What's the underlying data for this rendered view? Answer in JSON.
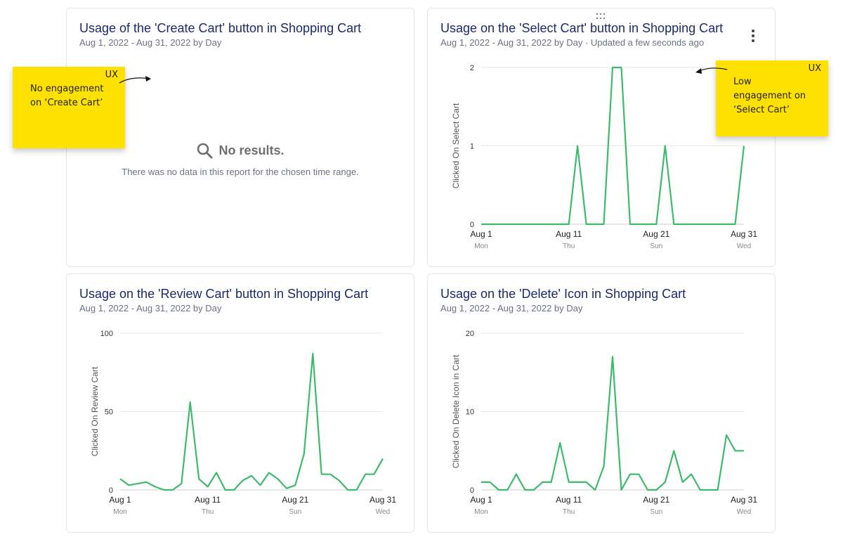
{
  "colors": {
    "line": "#3dbb6c",
    "title": "#1b2a6b",
    "sticky": "#ffe100",
    "grid": "#e6e6e6"
  },
  "cards": {
    "create": {
      "title": "Usage of the 'Create Cart' button in Shopping Cart",
      "subtitle": "Aug 1, 2022 - Aug 31, 2022 by Day",
      "empty_title": "No results.",
      "empty_message": "There was no data in this report for the chosen time range.",
      "empty_icon": "search-icon"
    },
    "select": {
      "title": "Usage on the 'Select Cart' button in Shopping Cart",
      "subtitle": "Aug 1, 2022 - Aug 31, 2022 by Day · Updated a few seconds ago",
      "menu_icon": "kebab-menu-icon",
      "drag_icon": "drag-handle-icon"
    },
    "review": {
      "title": "Usage on the 'Review Cart' button in Shopping Cart",
      "subtitle": "Aug 1, 2022 - Aug 31, 2022 by Day"
    },
    "delete": {
      "title": "Usage on the 'Delete' Icon in Shopping Cart",
      "subtitle": "Aug 1, 2022 - Aug 31, 2022 by Day"
    }
  },
  "stickies": {
    "create": {
      "tag": "UX",
      "text": "No engagement\non ‘Create Cart’"
    },
    "select": {
      "tag": "UX",
      "text": "Low\nengagement on\n‘Select Cart’"
    }
  },
  "chart_data": [
    {
      "type": "line",
      "title": "Usage on the 'Select Cart' button in Shopping Cart",
      "ylabel": "Clicked On Select Cart",
      "ylim": [
        0,
        2
      ],
      "yticks": [
        0,
        1,
        2
      ],
      "xlim": [
        1,
        31
      ],
      "xticks": [
        {
          "x": 1,
          "label": "Aug 1",
          "sub": "Mon"
        },
        {
          "x": 11,
          "label": "Aug 11",
          "sub": "Thu"
        },
        {
          "x": 21,
          "label": "Aug 21",
          "sub": "Sun"
        },
        {
          "x": 31,
          "label": "Aug 31",
          "sub": "Wed"
        }
      ],
      "grid": true,
      "x": [
        1,
        2,
        3,
        4,
        5,
        6,
        7,
        8,
        9,
        10,
        11,
        12,
        13,
        14,
        15,
        16,
        17,
        18,
        19,
        20,
        21,
        22,
        23,
        24,
        25,
        26,
        27,
        28,
        29,
        30,
        31
      ],
      "series": [
        {
          "values": [
            0,
            0,
            0,
            0,
            0,
            0,
            0,
            0,
            0,
            0,
            0,
            1,
            0,
            0,
            0,
            2,
            2,
            0,
            0,
            0,
            0,
            1,
            0,
            0,
            0,
            0,
            0,
            0,
            0,
            0,
            1
          ]
        }
      ]
    },
    {
      "type": "line",
      "title": "Usage on the 'Review Cart' button in Shopping Cart",
      "ylabel": "Clicked On Review Cart",
      "ylim": [
        0,
        100
      ],
      "yticks": [
        0,
        50,
        100
      ],
      "xlim": [
        1,
        31
      ],
      "xticks": [
        {
          "x": 1,
          "label": "Aug 1",
          "sub": "Mon"
        },
        {
          "x": 11,
          "label": "Aug 11",
          "sub": "Thu"
        },
        {
          "x": 21,
          "label": "Aug 21",
          "sub": "Sun"
        },
        {
          "x": 31,
          "label": "Aug 31",
          "sub": "Wed"
        }
      ],
      "grid": true,
      "x": [
        1,
        2,
        3,
        4,
        5,
        6,
        7,
        8,
        9,
        10,
        11,
        12,
        13,
        14,
        15,
        16,
        17,
        18,
        19,
        20,
        21,
        22,
        23,
        24,
        25,
        26,
        27,
        28,
        29,
        30,
        31
      ],
      "series": [
        {
          "values": [
            7,
            3,
            4,
            5,
            2,
            0,
            0,
            4,
            56,
            7,
            2,
            11,
            0,
            0,
            6,
            9,
            3,
            11,
            7,
            1,
            3,
            23,
            87,
            10,
            10,
            6,
            0,
            0,
            10,
            10,
            20
          ]
        }
      ]
    },
    {
      "type": "line",
      "title": "Usage on the 'Delete' Icon in Shopping Cart",
      "ylabel": "Clicked On Delete Icon in Cart",
      "ylim": [
        0,
        20
      ],
      "yticks": [
        0,
        10,
        20
      ],
      "xlim": [
        1,
        31
      ],
      "xticks": [
        {
          "x": 1,
          "label": "Aug 1",
          "sub": "Mon"
        },
        {
          "x": 11,
          "label": "Aug 11",
          "sub": "Thu"
        },
        {
          "x": 21,
          "label": "Aug 21",
          "sub": "Sun"
        },
        {
          "x": 31,
          "label": "Aug 31",
          "sub": "Wed"
        }
      ],
      "grid": true,
      "x": [
        1,
        2,
        3,
        4,
        5,
        6,
        7,
        8,
        9,
        10,
        11,
        12,
        13,
        14,
        15,
        16,
        17,
        18,
        19,
        20,
        21,
        22,
        23,
        24,
        25,
        26,
        27,
        28,
        29,
        30,
        31
      ],
      "series": [
        {
          "values": [
            1,
            1,
            0,
            0,
            2,
            0,
            0,
            1,
            1,
            6,
            1,
            1,
            1,
            0,
            3,
            17,
            0,
            2,
            2,
            0,
            0,
            1,
            5,
            1,
            2,
            0,
            0,
            0,
            7,
            5,
            5
          ]
        }
      ]
    }
  ]
}
